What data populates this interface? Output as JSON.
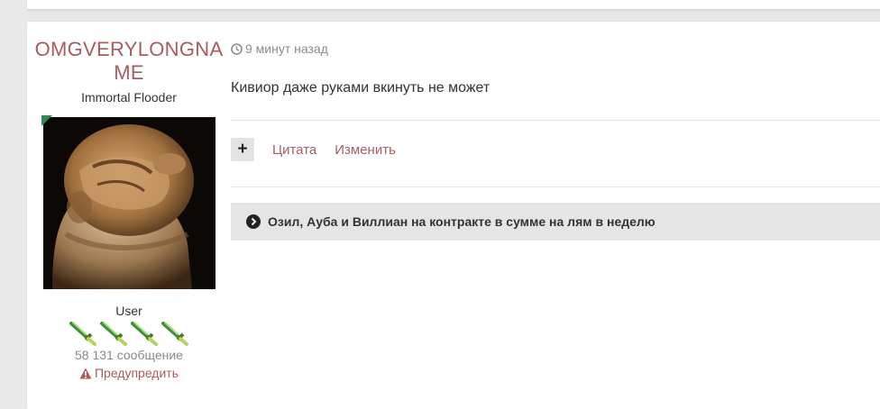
{
  "post": {
    "author": {
      "name": "OMGVERYLONGNAME",
      "title": "Immortal Flooder",
      "group": "User",
      "post_count": "58 131 сообщение",
      "warn_label": "Предупредить",
      "rank_icons": [
        "sword-icon",
        "sword-icon",
        "sword-icon",
        "sword-icon"
      ]
    },
    "time": "9 минут назад",
    "text": "Кивиор даже руками вкинуть не может",
    "actions": {
      "multiquote_label": "+",
      "quote_label": "Цитата",
      "edit_label": "Изменить"
    },
    "spoiler": {
      "title": "Озил, Ауба и Виллиан на контракте в сумме на лям в неделю"
    }
  },
  "colors": {
    "accent": "#a85c5c",
    "muted": "#8c8c8c",
    "online": "#2e8b57",
    "spoiler_bg": "#e5e5e5"
  }
}
